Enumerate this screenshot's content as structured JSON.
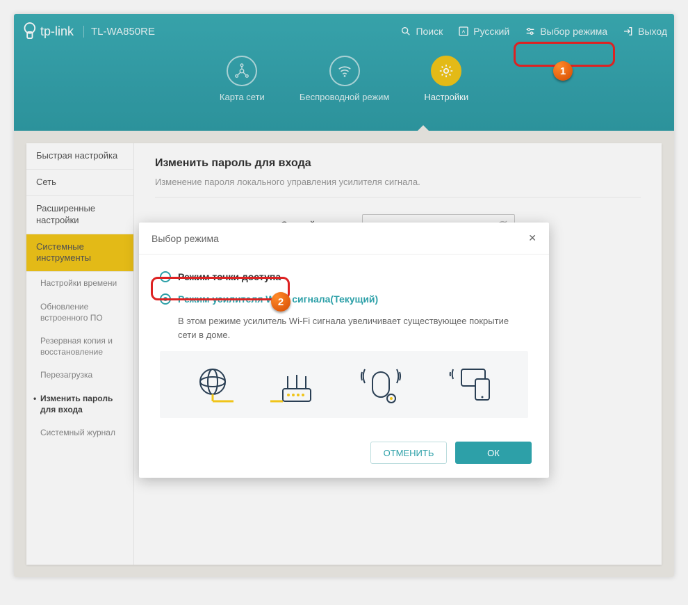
{
  "brand": "tp-link",
  "model": "TL-WA850RE",
  "top": {
    "search": "Поиск",
    "lang": "Русский",
    "mode": "Выбор режима",
    "logout": "Выход"
  },
  "tabs": {
    "map": "Карта сети",
    "wireless": "Беспроводной режим",
    "settings": "Настройки"
  },
  "sidebar": {
    "quick": "Быстрая настройка",
    "net": "Сеть",
    "adv": "Расширенные настройки",
    "tools": "Системные инструменты",
    "sub": {
      "time": "Настройки времени",
      "fw": "Обновление встроенного ПО",
      "backup": "Резервная копия и восстановление",
      "reboot": "Перезагрузка",
      "pw": "Изменить пароль для входа",
      "log": "Системный журнал"
    }
  },
  "main": {
    "title": "Изменить пароль для входа",
    "subtitle": "Изменение пароля локального управления усилителя сигнала.",
    "old_pw_label": "Старый пароль:"
  },
  "modal": {
    "title": "Выбор режима",
    "opt_ap": "Режим точки доступа",
    "opt_re": "Режим усилителя Wi-Fi сигнала",
    "opt_re_cur": "(Текущий)",
    "desc": "В этом режиме усилитель Wi-Fi сигнала увеличивает существующее покрытие сети в доме.",
    "cancel": "ОТМЕНИТЬ",
    "ok": "ОК"
  },
  "badges": {
    "one": "1",
    "two": "2"
  }
}
